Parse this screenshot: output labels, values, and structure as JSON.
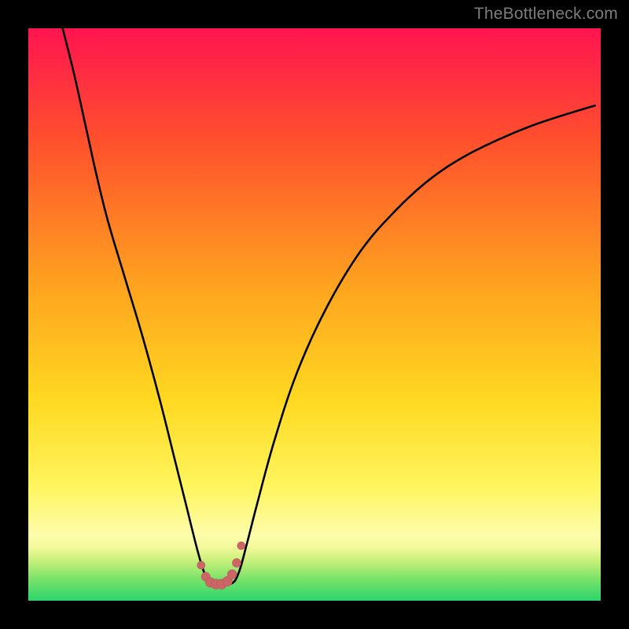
{
  "watermark": "TheBottleneck.com",
  "colors": {
    "bg": "#000000",
    "curve": "#000000",
    "marker_fill": "#cc6666",
    "marker_stroke": "#b85a5a",
    "gradient_stops": [
      {
        "offset": 0.0,
        "color": "#ff1450"
      },
      {
        "offset": 0.2,
        "color": "#ff512c"
      },
      {
        "offset": 0.45,
        "color": "#ffa31f"
      },
      {
        "offset": 0.65,
        "color": "#ffd921"
      },
      {
        "offset": 0.8,
        "color": "#fff55e"
      },
      {
        "offset": 0.885,
        "color": "#fdfcaa"
      },
      {
        "offset": 0.905,
        "color": "#f5fa9d"
      },
      {
        "offset": 0.93,
        "color": "#c7f07a"
      },
      {
        "offset": 0.96,
        "color": "#7ee36a"
      },
      {
        "offset": 1.0,
        "color": "#2bd56c"
      }
    ]
  },
  "chart_data": {
    "type": "line",
    "title": "",
    "xlabel": "",
    "ylabel": "",
    "xlim": [
      0,
      100
    ],
    "ylim": [
      0,
      100
    ],
    "series": [
      {
        "name": "curve",
        "x": [
          6,
          8,
          10,
          12,
          14,
          17,
          20,
          23,
          25.5,
          27.5,
          29.5,
          30.7,
          31.8,
          33.0,
          35.5,
          36.8,
          38.2,
          40,
          43,
          47,
          52,
          58,
          64,
          70,
          76,
          82,
          88,
          94,
          99
        ],
        "y": [
          100,
          92,
          83,
          74,
          66,
          56,
          46,
          35,
          25,
          17,
          9,
          5,
          3,
          3,
          3,
          5,
          10,
          17,
          28,
          40,
          51,
          61,
          68,
          73.5,
          77.5,
          80.5,
          83,
          85,
          86.5
        ]
      }
    ],
    "markers": {
      "name": "trough-markers",
      "x": [
        30.2,
        31.0,
        31.8,
        32.8,
        33.8,
        34.8,
        35.6,
        36.4,
        37.2
      ],
      "y": [
        6.2,
        4.2,
        3.2,
        2.9,
        2.9,
        3.4,
        4.6,
        6.6,
        9.6
      ],
      "size": [
        5.0,
        5.6,
        6.1,
        6.4,
        6.4,
        6.2,
        5.9,
        5.5,
        5.0
      ]
    }
  }
}
